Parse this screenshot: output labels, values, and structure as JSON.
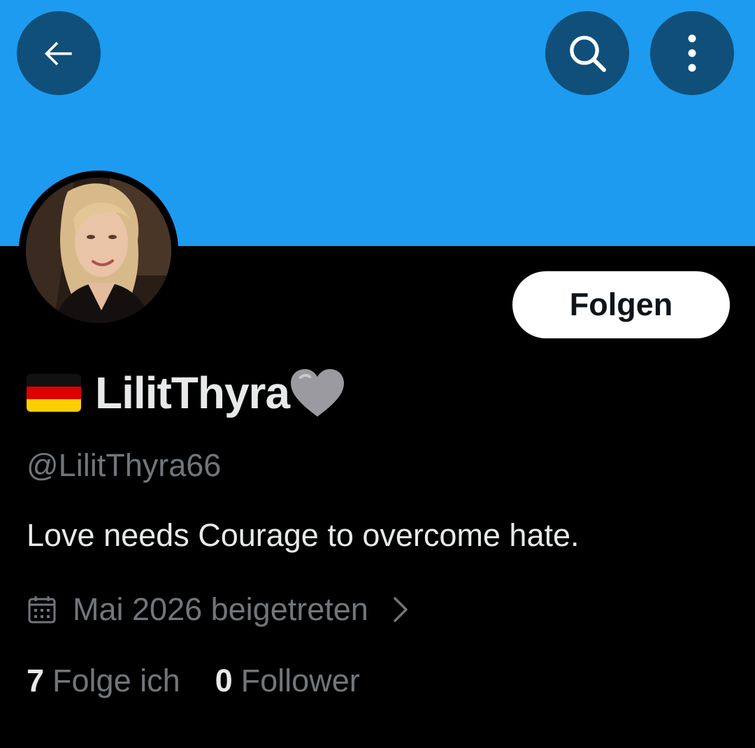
{
  "banner": {
    "color": "#1d9bf0"
  },
  "header": {
    "back_icon": "arrow-left-icon",
    "search_icon": "search-icon",
    "more_icon": "more-vertical-icon"
  },
  "profile": {
    "avatar": "avatar-photo",
    "follow_label": "Folgen",
    "flag_icon": "germany-flag-emoji",
    "display_name": "LilitThyra",
    "heart_icon": "grey-heart-emoji",
    "handle": "@LilitThyra66",
    "bio": "Love needs Courage to overcome hate.",
    "joined_icon": "calendar-icon",
    "joined": "Mai 2026 beigetreten",
    "joined_chevron": "chevron-right-icon"
  },
  "stats": {
    "following_count": "7",
    "following_label": "Folge ich",
    "followers_count": "0",
    "followers_label": "Follower"
  }
}
